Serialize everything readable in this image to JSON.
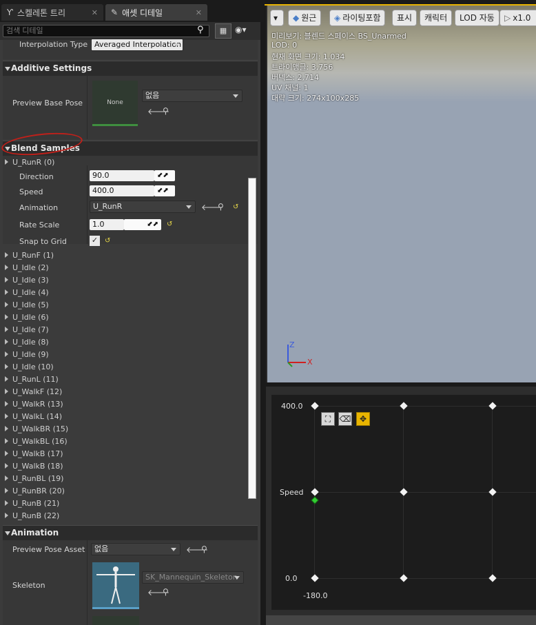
{
  "tabs": {
    "skeleton_tree": "스켈레톤 트리",
    "asset_details": "애셋 디테일",
    "close": "✕"
  },
  "search": {
    "placeholder": "검색 디테일"
  },
  "interpolation": {
    "label": "Interpolation Type",
    "value": "Averaged Interpolation"
  },
  "additive": {
    "header": "Additive Settings",
    "preview_base_pose_label": "Preview Base Pose",
    "thumb_text": "None",
    "combo_value": "없음"
  },
  "blend_samples": {
    "header": "Blend Samples",
    "expanded_item": "U_RunR (0)",
    "direction_label": "Direction",
    "direction_value": "90.0",
    "speed_label": "Speed",
    "speed_value": "400.0",
    "animation_label": "Animation",
    "animation_value": "U_RunR",
    "rate_scale_label": "Rate Scale",
    "rate_scale_value": "1.0",
    "snap_label": "Snap to Grid",
    "items": [
      "U_RunF (1)",
      "U_Idle (2)",
      "U_Idle (3)",
      "U_Idle (4)",
      "U_Idle (5)",
      "U_Idle (6)",
      "U_Idle (7)",
      "U_Idle (8)",
      "U_Idle (9)",
      "U_Idle (10)",
      "U_RunL (11)",
      "U_WalkF (12)",
      "U_WalkR (13)",
      "U_WalkL (14)",
      "U_WalkBR (15)",
      "U_WalkBL (16)",
      "U_WalkB (17)",
      "U_WalkB (18)",
      "U_RunBL (19)",
      "U_RunBR (20)",
      "U_RunB (21)",
      "U_RunB (22)"
    ]
  },
  "animation": {
    "header": "Animation",
    "preview_pose_label": "Preview Pose Asset",
    "preview_pose_value": "없음",
    "skeleton_label": "Skeleton",
    "skeleton_value": "SK_Mannequin_Skeleton"
  },
  "viewport": {
    "buttons": {
      "perspective": "원근",
      "lit": "라이팅포함",
      "show": "표시",
      "character": "캐릭터",
      "lod": "LOD 자동",
      "speed": "x1.0"
    },
    "stats": [
      "미리보기: 블렌드 스페이스 BS_Unarmed",
      "LOD: 0",
      "현재 화면 크기: 1.034",
      "트라이앵글: 3,756",
      "버텍스: 2,714",
      "UV 채널: 1",
      "대략 크기: 274x100x285"
    ],
    "axis_z": "Z",
    "axis_x": "X"
  },
  "graph": {
    "y_max": "400.0",
    "y_label": "Speed",
    "y_min": "0.0",
    "x_min": "-180.0"
  },
  "colors": {
    "accent_yellow": "#e8b400",
    "annotation_red": "#c0201a",
    "sample_green": "#33cc33"
  }
}
